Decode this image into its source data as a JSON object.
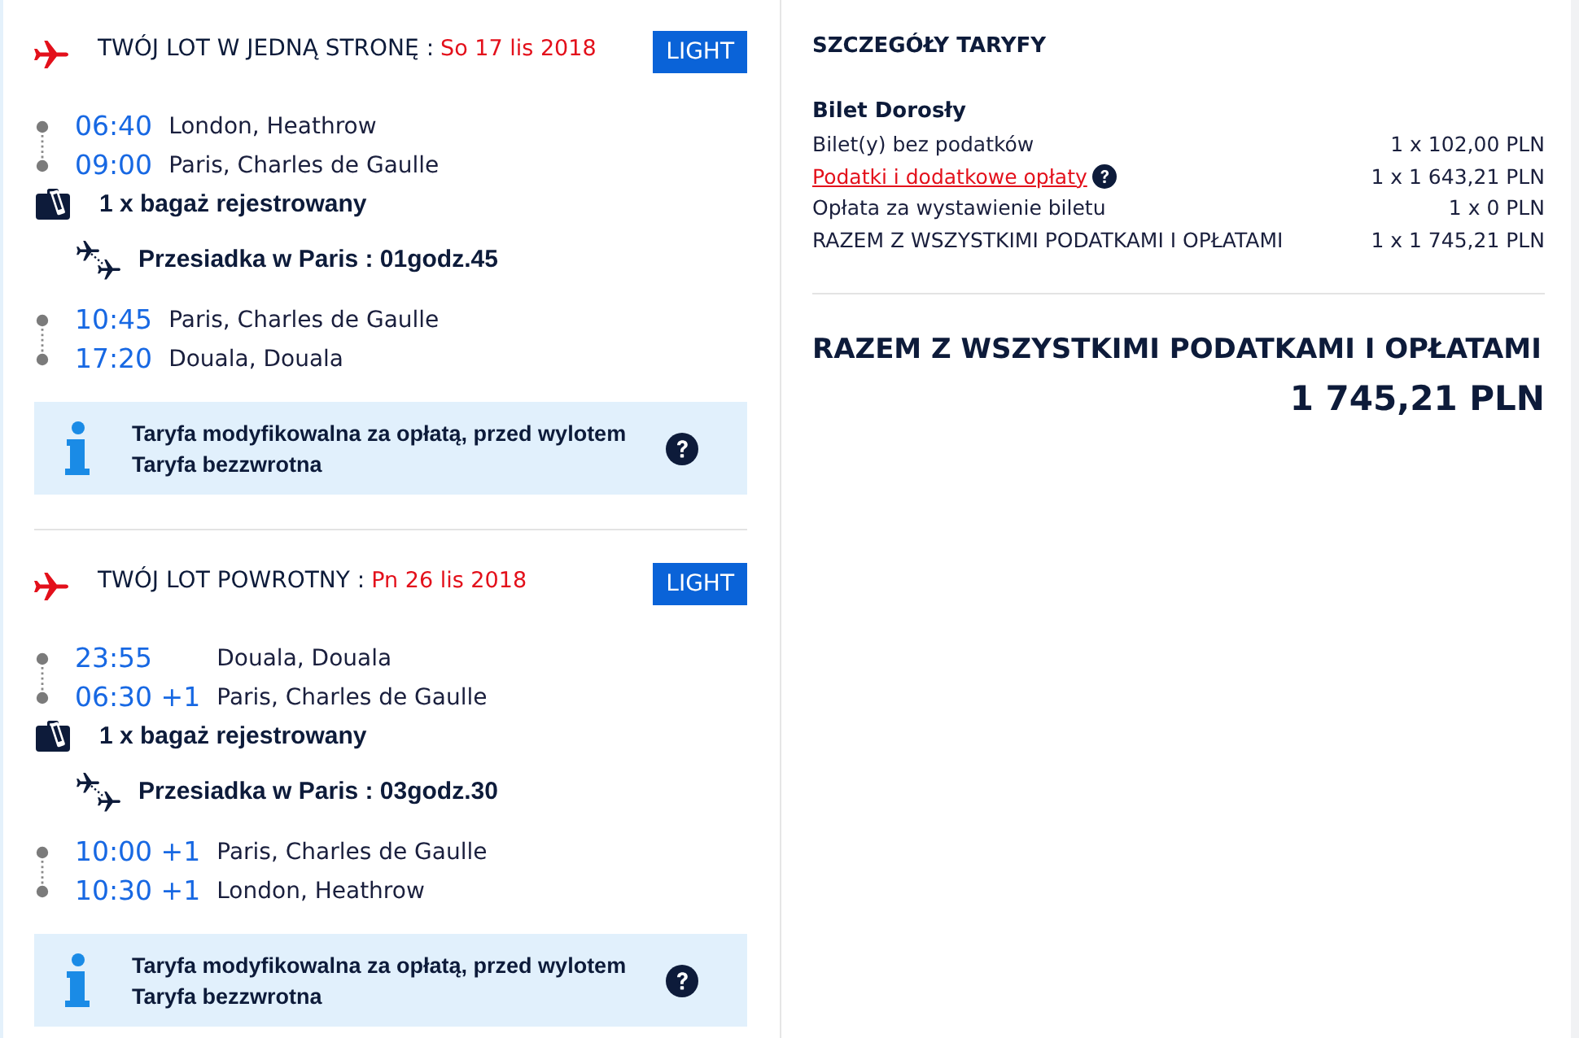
{
  "flights": [
    {
      "title": "TWÓJ LOT W JEDNĄ STRONĘ :",
      "date": "So 17 lis 2018",
      "fare_badge": "LIGHT",
      "segments": [
        {
          "kind": "leg",
          "stops": [
            {
              "time": "06:40",
              "place": "London, Heathrow"
            },
            {
              "time": "09:00",
              "place": "Paris, Charles de Gaulle"
            }
          ]
        },
        {
          "kind": "baggage",
          "text": "1 x bagaż rejestrowany"
        },
        {
          "kind": "connection",
          "text": "Przesiadka w Paris : 01godz.45"
        },
        {
          "kind": "leg",
          "stops": [
            {
              "time": "10:45",
              "place": "Paris, Charles de Gaulle"
            },
            {
              "time": "17:20",
              "place": "Douala, Douala"
            }
          ]
        }
      ],
      "fare_notes": [
        "Taryfa modyfikowalna za opłatą, przed wylotem",
        "Taryfa bezzwrotna"
      ]
    },
    {
      "title": "TWÓJ LOT POWROTNY :",
      "date": "Pn 26 lis 2018",
      "fare_badge": "LIGHT",
      "segments": [
        {
          "kind": "leg",
          "stops": [
            {
              "time": "23:55",
              "place": "Douala, Douala"
            },
            {
              "time": "06:30 +1",
              "place": "Paris, Charles de Gaulle"
            }
          ]
        },
        {
          "kind": "baggage",
          "text": "1 x bagaż rejestrowany"
        },
        {
          "kind": "connection",
          "text": "Przesiadka w Paris : 03godz.30"
        },
        {
          "kind": "leg",
          "stops": [
            {
              "time": "10:00 +1",
              "place": "Paris, Charles de Gaulle"
            },
            {
              "time": "10:30 +1",
              "place": "London, Heathrow"
            }
          ]
        }
      ],
      "fare_notes": [
        "Taryfa modyfikowalna za opłatą, przed wylotem",
        "Taryfa bezzwrotna"
      ]
    }
  ],
  "fare_details": {
    "title": "SZCZEGÓŁY TARYFY",
    "passenger": "Bilet Dorosły",
    "rows": [
      {
        "kind": "plain",
        "label": "Bilet(y) bez podatków",
        "amount": "1 x 102,00 PLN"
      },
      {
        "kind": "link",
        "label": "Podatki i dodatkowe opłaty",
        "amount": "1 x 1 643,21 PLN"
      },
      {
        "kind": "plain",
        "label": "Opłata za wystawienie biletu",
        "amount": "1 x 0 PLN"
      },
      {
        "kind": "plain",
        "label": "RAZEM Z WSZYSTKIMI PODATKAMI I OPŁATAMI",
        "amount": "1 x 1 745,21 PLN"
      }
    ]
  },
  "total": {
    "label": "RAZEM Z WSZYSTKIMI PODATKAMI I OPŁATAMI",
    "amount": "1 745,21 PLN"
  }
}
